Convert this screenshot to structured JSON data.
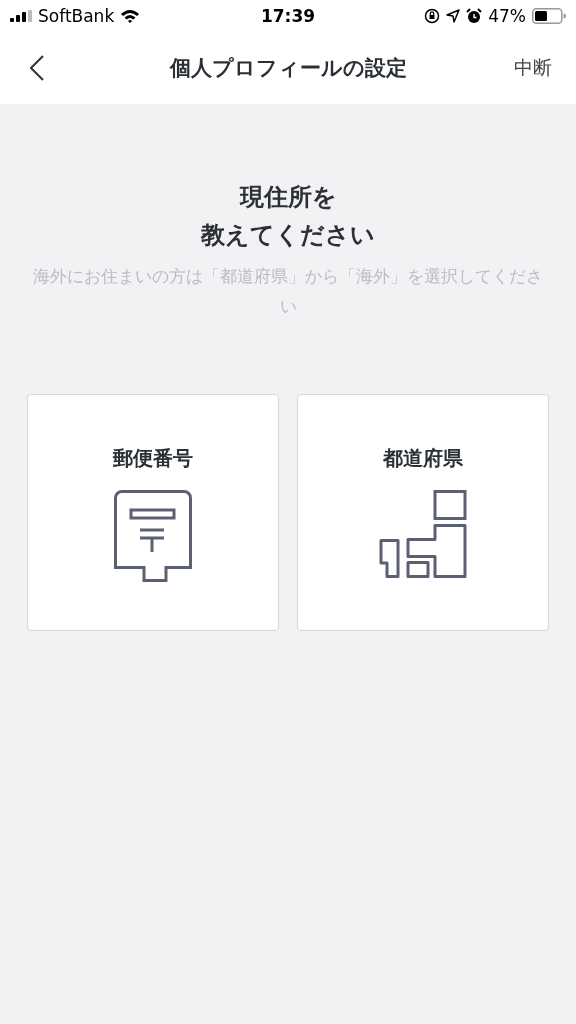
{
  "status_bar": {
    "carrier": "SoftBank",
    "time": "17:39",
    "battery": "47%"
  },
  "nav": {
    "title": "個人プロフィールの設定",
    "action": "中断"
  },
  "heading": {
    "lines": [
      "現住所を",
      "教えてください"
    ],
    "note": "海外にお住まいの方は「都道府県」から「海外」を選択してください"
  },
  "options": [
    {
      "kind": "postal",
      "label": "郵便番号"
    },
    {
      "kind": "prefecture",
      "label": "都道府県"
    }
  ]
}
